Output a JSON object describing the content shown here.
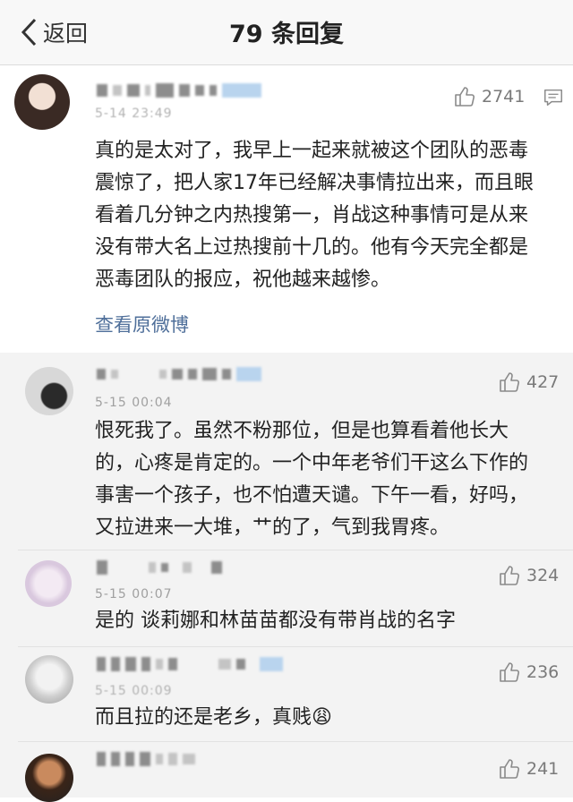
{
  "nav": {
    "back_label": "返回",
    "title": "79 条回复"
  },
  "comments": [
    {
      "likes": "2741",
      "time": "5-14 23:49",
      "text": "真的是太对了，我早上一起来就被这个团队的恶毒震惊了，把人家17年已经解决事情拉出来，而且眼看着几分钟之内热搜第一，肖战这种事情可是从来没有带大名上过热搜前十几的。他有今天完全都是恶毒团队的报应，祝他越来越惨。",
      "view_original": "查看原微博"
    },
    {
      "likes": "427",
      "time": "5-15 00:04",
      "text": "恨死我了。虽然不粉那位，但是也算看着他长大的，心疼是肯定的。一个中年老爷们干这么下作的事害一个孩子，也不怕遭天谴。下午一看，好吗，又拉进来一大堆，艹的了，气到我胃疼。"
    },
    {
      "likes": "324",
      "time": "5-15 00:07",
      "text": "是的 谈莉娜和林苗苗都没有带肖战的名字"
    },
    {
      "likes": "236",
      "time": "5-15 00:09",
      "text": "而且拉的还是老乡，真贱😩"
    },
    {
      "likes": "241"
    }
  ]
}
